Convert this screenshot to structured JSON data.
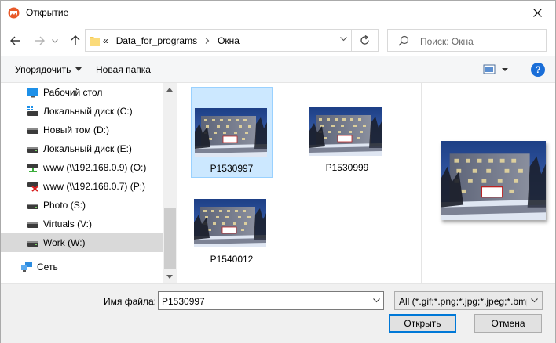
{
  "window": {
    "title": "Открытие",
    "app_icon": "image-app-icon",
    "close_icon": "close-icon"
  },
  "address": {
    "overflow_label": "«",
    "crumbs": [
      "Data_for_programs",
      "Окна"
    ]
  },
  "search": {
    "placeholder": "Поиск: Окна"
  },
  "toolbar": {
    "organize": "Упорядочить",
    "new_folder": "Новая папка",
    "help": "?"
  },
  "nav": {
    "items": [
      {
        "label": "Рабочий стол",
        "icon": "desktop-icon"
      },
      {
        "label": "Локальный диск (C:)",
        "icon": "system-drive-icon"
      },
      {
        "label": "Новый том (D:)",
        "icon": "drive-icon"
      },
      {
        "label": "Локальный диск (E:)",
        "icon": "drive-icon"
      },
      {
        "label": "www (\\\\192.168.0.9) (O:)",
        "icon": "network-drive-icon"
      },
      {
        "label": "www (\\\\192.168.0.7) (P:)",
        "icon": "disconnected-network-drive-icon"
      },
      {
        "label": "Photo (S:)",
        "icon": "drive-icon"
      },
      {
        "label": "Virtuals (V:)",
        "icon": "drive-icon"
      },
      {
        "label": "Work (W:)",
        "icon": "drive-icon",
        "selected": true
      }
    ],
    "network": {
      "label": "Сеть",
      "icon": "network-icon"
    }
  },
  "files": [
    {
      "name": "P1530997",
      "selected": true
    },
    {
      "name": "P1530999"
    },
    {
      "name": "P1540012"
    }
  ],
  "bottom": {
    "filename_label": "Имя файла:",
    "filename_value": "P1530997",
    "filetype_value": "All (*.gif;*.png;*.jpg;*.jpeg;*.bmp)",
    "open_label": "Открыть",
    "cancel_label": "Отмена"
  },
  "colors": {
    "accent": "#0078d7",
    "selection": "#cce8ff",
    "help": "#1a6ed8"
  }
}
